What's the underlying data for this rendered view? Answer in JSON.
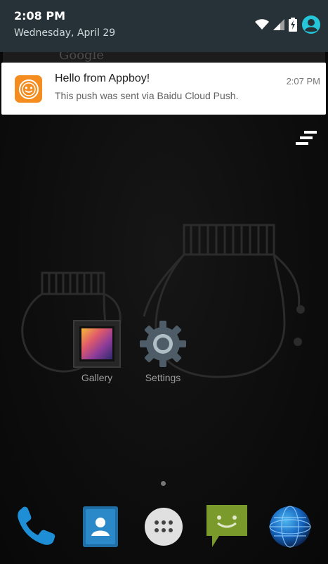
{
  "status_bar": {
    "time": "2:08 PM",
    "date": "Wednesday, April 29",
    "icons": [
      "wifi-icon",
      "cell-signal-icon",
      "battery-charging-icon",
      "user-account-icon"
    ]
  },
  "background_widget": {
    "text": "Google"
  },
  "notification": {
    "title": "Hello from Appboy!",
    "text": "This push was sent via Baidu Cloud Push.",
    "time": "2:07 PM",
    "icon": "appboy-app-icon"
  },
  "clear_all": {
    "icon": "clear-all-icon"
  },
  "apps": [
    {
      "label": "Gallery",
      "icon": "gallery-icon"
    },
    {
      "label": "Settings",
      "icon": "settings-gear-icon"
    }
  ],
  "page_indicator": {
    "pages": 1,
    "current": 1
  },
  "dock": [
    {
      "name": "phone",
      "icon": "phone-icon"
    },
    {
      "name": "contacts",
      "icon": "contacts-icon"
    },
    {
      "name": "app-drawer",
      "icon": "app-drawer-icon"
    },
    {
      "name": "messaging",
      "icon": "messaging-icon"
    },
    {
      "name": "browser",
      "icon": "browser-globe-icon"
    }
  ],
  "colors": {
    "shade_background": "#263238",
    "notification_background": "#ffffff",
    "appboy_orange": "#f58c1f",
    "account_accent": "#26c6da"
  }
}
